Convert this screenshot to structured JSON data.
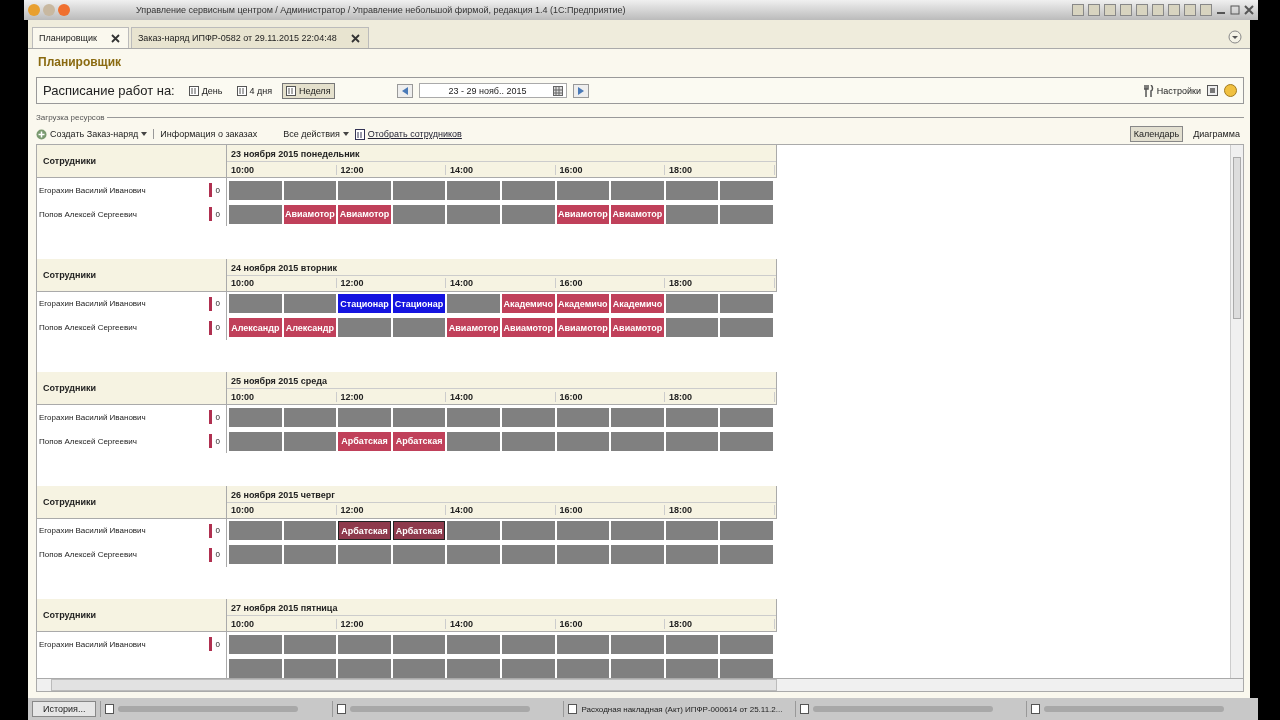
{
  "window": {
    "title": "Управление сервисным центром / Администратор / Управление небольшой фирмой, редакция 1.4  (1С:Предприятие)"
  },
  "tabs": [
    {
      "label": "Планировщик",
      "selected": true
    },
    {
      "label": "Заказ-наряд ИПФР-0582 от 29.11.2015 22:04:48",
      "selected": false
    }
  ],
  "page_title": "Планировщик",
  "toolbar": {
    "label": "Расписание работ на:",
    "periods": [
      {
        "label": "День",
        "selected": false
      },
      {
        "label": "4 дня",
        "selected": false
      },
      {
        "label": "Неделя",
        "selected": true
      }
    ],
    "date_range": "23 - 29 нояб.. 2015",
    "settings": "Настройки"
  },
  "section_title": "Загрузка ресурсов",
  "commands": {
    "create": "Создать Заказ-наряд",
    "info": "Информация о заказах",
    "all_actions": "Все действия",
    "select_staff": "Отобрать сотрудников",
    "views": [
      {
        "label": "Календарь",
        "selected": true
      },
      {
        "label": "Диаграмма",
        "selected": false
      }
    ]
  },
  "schedule": {
    "days": [
      {
        "column_header": "Сотрудники",
        "date": "23 ноября 2015 понедельник",
        "times": [
          "10:00",
          "12:00",
          "14:00",
          "16:00",
          "18:00"
        ],
        "rows": [
          {
            "name": "Егорахин Василий Иванович",
            "count": "0",
            "slots": [
              {
                "color": "#808080"
              },
              {
                "color": "#808080"
              },
              {
                "color": "#808080"
              },
              {
                "color": "#808080"
              },
              {
                "color": "#808080"
              },
              {
                "color": "#808080"
              },
              {
                "color": "#808080"
              },
              {
                "color": "#808080"
              },
              {
                "color": "#808080"
              },
              {
                "color": "#808080"
              }
            ]
          },
          {
            "name": "Попов Алексей Сергеевич",
            "count": "0",
            "slots": [
              {
                "color": "#808080"
              },
              {
                "text": "Авиамотор",
                "color": "#c0405a"
              },
              {
                "text": "Авиамотор",
                "color": "#c0405a"
              },
              {
                "color": "#808080"
              },
              {
                "color": "#808080"
              },
              {
                "color": "#808080"
              },
              {
                "text": "Авиамотор",
                "color": "#c0405a"
              },
              {
                "text": "Авиамотор",
                "color": "#c0405a"
              },
              {
                "color": "#808080"
              },
              {
                "color": "#808080"
              }
            ]
          }
        ]
      },
      {
        "column_header": "Сотрудники",
        "date": "24 ноября 2015 вторник",
        "times": [
          "10:00",
          "12:00",
          "14:00",
          "16:00",
          "18:00"
        ],
        "rows": [
          {
            "name": "Егорахин Василий Иванович",
            "count": "0",
            "slots": [
              {
                "color": "#808080"
              },
              {
                "color": "#808080"
              },
              {
                "text": "Стационар",
                "color": "#1414e0"
              },
              {
                "text": "Стационар",
                "color": "#1414e0"
              },
              {
                "color": "#808080"
              },
              {
                "text": "Академичо",
                "color": "#c0405a"
              },
              {
                "text": "Академичо",
                "color": "#c0405a"
              },
              {
                "text": "Академичо",
                "color": "#c0405a"
              },
              {
                "color": "#808080"
              },
              {
                "color": "#808080"
              }
            ]
          },
          {
            "name": "Попов Алексей Сергеевич",
            "count": "0",
            "slots": [
              {
                "text": "Александр",
                "color": "#c0405a"
              },
              {
                "text": "Александр",
                "color": "#c0405a"
              },
              {
                "color": "#808080"
              },
              {
                "color": "#808080"
              },
              {
                "text": "Авиамотор",
                "color": "#c0405a"
              },
              {
                "text": "Авиамотор",
                "color": "#c0405a"
              },
              {
                "text": "Авиамотор",
                "color": "#c0405a"
              },
              {
                "text": "Авиамотор",
                "color": "#c0405a"
              },
              {
                "color": "#808080"
              },
              {
                "color": "#808080"
              }
            ]
          }
        ]
      },
      {
        "column_header": "Сотрудники",
        "date": "25 ноября 2015 среда",
        "times": [
          "10:00",
          "12:00",
          "14:00",
          "16:00",
          "18:00"
        ],
        "rows": [
          {
            "name": "Егорахин Василий Иванович",
            "count": "0",
            "slots": [
              {
                "color": "#808080"
              },
              {
                "color": "#808080"
              },
              {
                "color": "#808080"
              },
              {
                "color": "#808080"
              },
              {
                "color": "#808080"
              },
              {
                "color": "#808080"
              },
              {
                "color": "#808080"
              },
              {
                "color": "#808080"
              },
              {
                "color": "#808080"
              },
              {
                "color": "#808080"
              }
            ]
          },
          {
            "name": "Попов Алексей Сергеевич",
            "count": "0",
            "slots": [
              {
                "color": "#808080"
              },
              {
                "color": "#808080"
              },
              {
                "text": "Арбатская",
                "color": "#c0405a"
              },
              {
                "text": "Арбатская",
                "color": "#c0405a"
              },
              {
                "color": "#808080"
              },
              {
                "color": "#808080"
              },
              {
                "color": "#808080"
              },
              {
                "color": "#808080"
              },
              {
                "color": "#808080"
              },
              {
                "color": "#808080"
              }
            ]
          }
        ]
      },
      {
        "column_header": "Сотрудники",
        "date": "26 ноября 2015 четверг",
        "times": [
          "10:00",
          "12:00",
          "14:00",
          "16:00",
          "18:00"
        ],
        "rows": [
          {
            "name": "Егорахин Василий Иванович",
            "count": "0",
            "slots": [
              {
                "color": "#808080"
              },
              {
                "color": "#808080"
              },
              {
                "text": "Арбатская",
                "color": "#8e3a4c"
              },
              {
                "text": "Арбатская",
                "color": "#8e3a4c"
              },
              {
                "color": "#808080"
              },
              {
                "color": "#808080"
              },
              {
                "color": "#808080"
              },
              {
                "color": "#808080"
              },
              {
                "color": "#808080"
              },
              {
                "color": "#808080"
              }
            ]
          },
          {
            "name": "Попов Алексей Сергеевич",
            "count": "0",
            "slots": [
              {
                "color": "#808080"
              },
              {
                "color": "#808080"
              },
              {
                "color": "#808080"
              },
              {
                "color": "#808080"
              },
              {
                "color": "#808080"
              },
              {
                "color": "#808080"
              },
              {
                "color": "#808080"
              },
              {
                "color": "#808080"
              },
              {
                "color": "#808080"
              },
              {
                "color": "#808080"
              }
            ]
          }
        ]
      },
      {
        "column_header": "Сотрудники",
        "date": "27 ноября 2015 пятница",
        "times": [
          "10:00",
          "12:00",
          "14:00",
          "16:00",
          "18:00"
        ],
        "rows": [
          {
            "name": "Егорахин Василий Иванович",
            "count": "0",
            "slots": [
              {
                "color": "#808080"
              },
              {
                "color": "#808080"
              },
              {
                "color": "#808080"
              },
              {
                "color": "#808080"
              },
              {
                "color": "#808080"
              },
              {
                "color": "#808080"
              },
              {
                "color": "#808080"
              },
              {
                "color": "#808080"
              },
              {
                "color": "#808080"
              },
              {
                "color": "#808080"
              }
            ]
          },
          {
            "slots": [
              {
                "color": "#808080"
              },
              {
                "color": "#808080"
              },
              {
                "color": "#808080"
              },
              {
                "color": "#808080"
              },
              {
                "color": "#808080"
              },
              {
                "color": "#808080"
              },
              {
                "color": "#808080"
              },
              {
                "color": "#808080"
              },
              {
                "color": "#808080"
              },
              {
                "color": "#808080"
              }
            ]
          }
        ]
      }
    ]
  },
  "taskbar": {
    "history": "История...",
    "items": [
      {
        "kind": "blurred"
      },
      {
        "kind": "blurred"
      },
      {
        "kind": "labeled",
        "label": "Расходная накладная (Акт) ИПФР-000614 от 25.11.2..."
      },
      {
        "kind": "blurred"
      },
      {
        "kind": "blurred"
      }
    ]
  }
}
